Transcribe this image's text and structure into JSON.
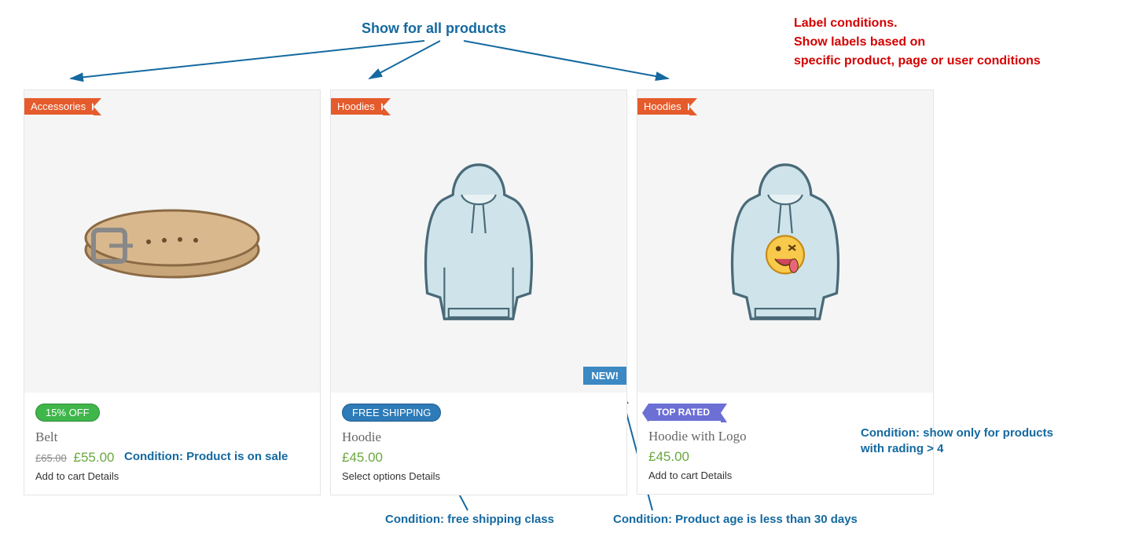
{
  "annotations": {
    "showAll": "Show for all products",
    "header": "Label conditions.\nShow labels based on\nspecific product, page or user conditions",
    "cond_sale": "Condition: Product is on sale",
    "cond_freeship": "Condition: free shipping class",
    "cond_age": "Condition: Product age is less than 30 days",
    "cond_rating": "Condition: show only for products\nwith rading > 4"
  },
  "products": [
    {
      "category": "Accessories",
      "badge": {
        "text": "15% OFF",
        "style": "green-pill"
      },
      "name": "Belt",
      "price_old": "£65.00",
      "price": "£55.00",
      "action1": "Add to cart",
      "action2": "Details"
    },
    {
      "category": "Hoodies",
      "corner": "NEW!",
      "badge": {
        "text": "FREE SHIPPING",
        "style": "blue-pill"
      },
      "name": "Hoodie",
      "price": "£45.00",
      "action1": "Select options",
      "action2": "Details"
    },
    {
      "category": "Hoodies",
      "badge": {
        "text": "TOP RATED",
        "style": "arrow-tag"
      },
      "name": "Hoodie with Logo",
      "price": "£45.00",
      "action1": "Add to cart",
      "action2": "Details"
    }
  ]
}
